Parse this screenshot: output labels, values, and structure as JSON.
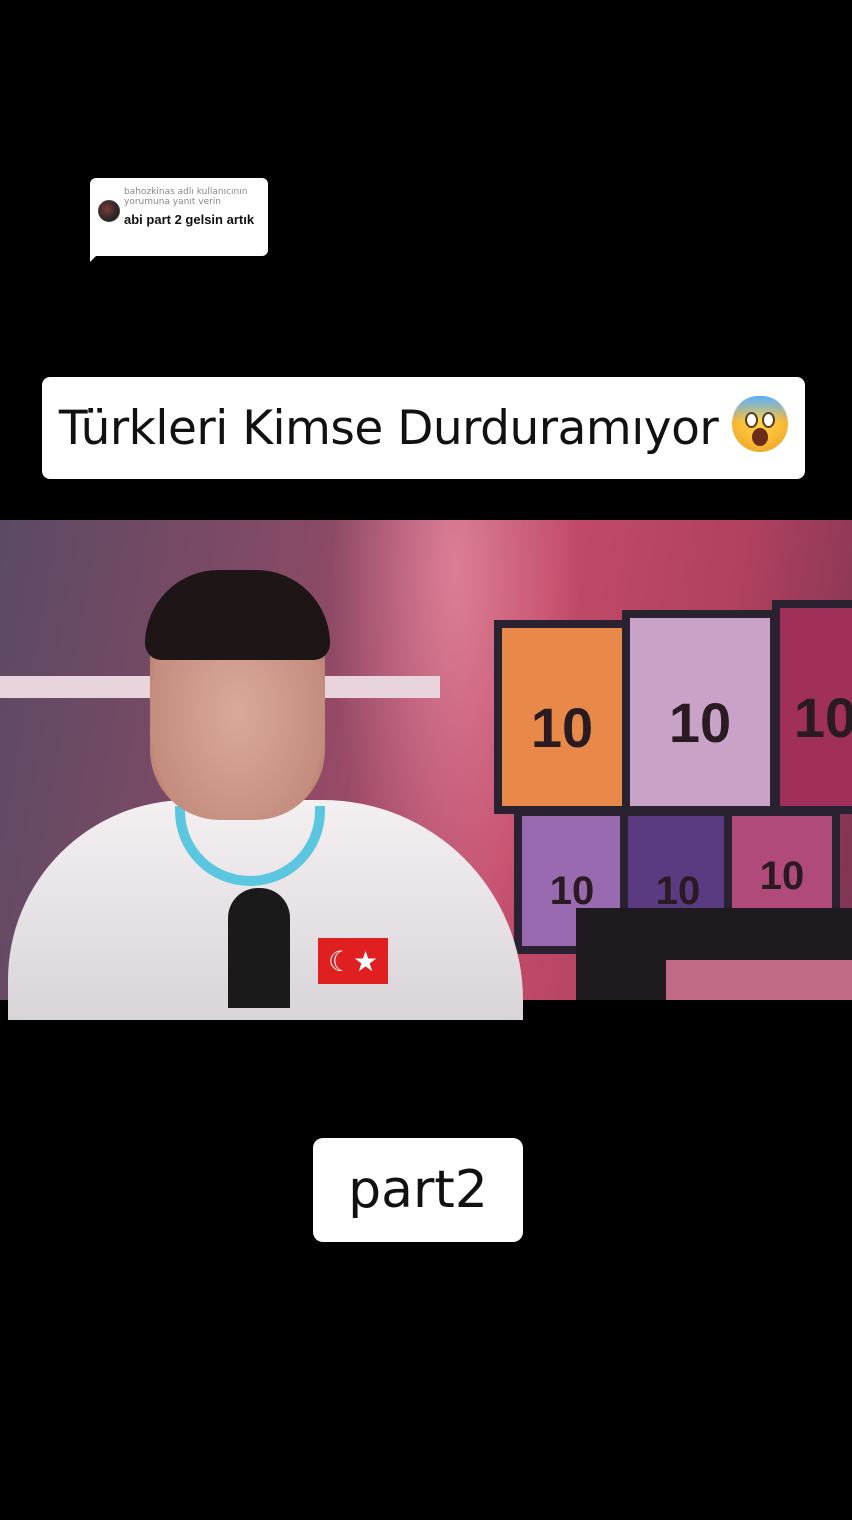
{
  "reply": {
    "meta": "bahozkinas adlı kullanıcının yorumuna yanıt verin",
    "text": "abi part 2 gelsin artık"
  },
  "title": {
    "text": "Türkleri Kimse Durduramıyor",
    "emoji_icon": "face-screaming-in-fear-icon"
  },
  "video": {
    "jerseys": [
      "10",
      "10",
      "10",
      "10",
      "10",
      "10"
    ]
  },
  "part_label": "part2"
}
